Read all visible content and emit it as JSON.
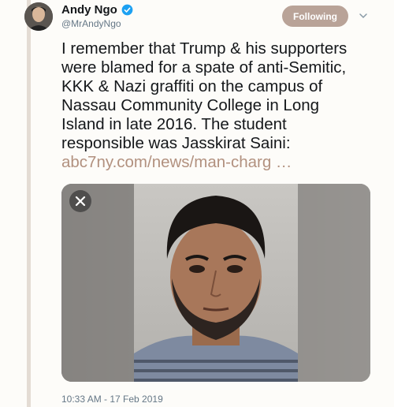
{
  "author": {
    "name": "Andy Ngo",
    "handle": "@MrAndyNgo",
    "verified_icon": "verified-badge-icon",
    "avatar_icon": "profile-photo"
  },
  "follow_button": {
    "label": "Following"
  },
  "menu": {
    "icon": "chevron-down-icon"
  },
  "tweet": {
    "lines": [
      "I remember that Trump & his supporters",
      "were blamed for a spate of anti-Semitic,",
      "KKK & Nazi graffiti on the campus of",
      "Nassau Community College in Long",
      "Island in late 2016. The student",
      "responsible was Jasskirat Saini:"
    ],
    "link": "abc7ny.com/news/man-charg  …"
  },
  "media": {
    "close_icon": "close-icon",
    "image": "mugshot-photo"
  },
  "timestamp": "10:33 AM - 17 Feb 2019",
  "colors": {
    "link": "#b2917f",
    "follow_button": "#b9a398",
    "verified": "#1da1f2",
    "thread_bar": "#e4dcd4"
  }
}
